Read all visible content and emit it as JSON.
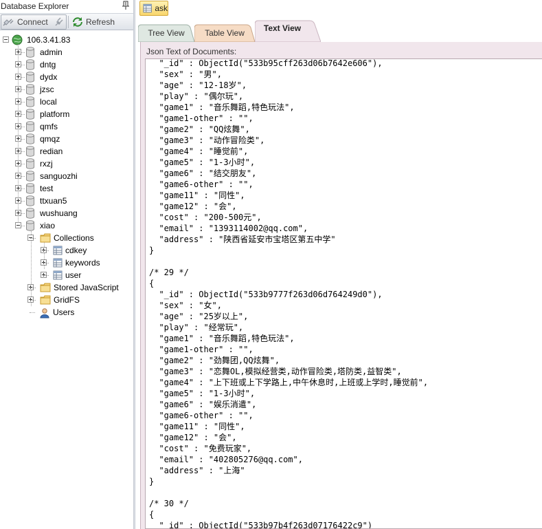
{
  "panel": {
    "title": "Database Explorer"
  },
  "toolbar": {
    "connect_label": "Connect",
    "refresh_label": "Refresh"
  },
  "tree": {
    "server": "106.3.41.83",
    "databases": [
      "admin",
      "dntg",
      "dydx",
      "jzsc",
      "local",
      "platform",
      "qmfs",
      "qmqz",
      "redian",
      "rxzj",
      "sanguozhi",
      "test",
      "ttxuan5",
      "wushuang",
      "xiao"
    ],
    "collections_label": "Collections",
    "collections": [
      "cdkey",
      "keywords",
      "user"
    ],
    "stored_js_label": "Stored JavaScript",
    "gridfs_label": "GridFS",
    "users_label": "Users"
  },
  "doc_tab": {
    "label": "ask"
  },
  "view_tabs": [
    "Tree View",
    "Table View",
    "Text View"
  ],
  "active_tab": "Text View",
  "json_caption": "Json Text of Documents:",
  "code_lines": [
    "  \"_id\" : ObjectId(\"533b95cff263d06b7642e606\"),",
    "  \"sex\" : \"男\",",
    "  \"age\" : \"12-18岁\",",
    "  \"play\" : \"偶尔玩\",",
    "  \"game1\" : \"音乐舞蹈,特色玩法\",",
    "  \"game1-other\" : \"\",",
    "  \"game2\" : \"QQ炫舞\",",
    "  \"game3\" : \"动作冒险类\",",
    "  \"game4\" : \"睡觉前\",",
    "  \"game5\" : \"1-3小时\",",
    "  \"game6\" : \"结交朋友\",",
    "  \"game6-other\" : \"\",",
    "  \"game11\" : \"同性\",",
    "  \"game12\" : \"会\",",
    "  \"cost\" : \"200-500元\",",
    "  \"email\" : \"1393114002@qq.com\",",
    "  \"address\" : \"陕西省延安市宝塔区第五中学\"",
    "}",
    "",
    "/* 29 */",
    "{",
    "  \"_id\" : ObjectId(\"533b9777f263d06d764249d0\"),",
    "  \"sex\" : \"女\",",
    "  \"age\" : \"25岁以上\",",
    "  \"play\" : \"经常玩\",",
    "  \"game1\" : \"音乐舞蹈,特色玩法\",",
    "  \"game1-other\" : \"\",",
    "  \"game2\" : \"劲舞团,QQ炫舞\",",
    "  \"game3\" : \"恋舞OL,模拟经营类,动作冒险类,塔防类,益智类\",",
    "  \"game4\" : \"上下班或上下学路上,中午休息时,上班或上学时,睡觉前\",",
    "  \"game5\" : \"1-3小时\",",
    "  \"game6\" : \"娱乐消遣\",",
    "  \"game6-other\" : \"\",",
    "  \"game11\" : \"同性\",",
    "  \"game12\" : \"会\",",
    "  \"cost\" : \"免费玩家\",",
    "  \"email\" : \"402805276@qq.com\",",
    "  \"address\" : \"上海\"",
    "}",
    "",
    "/* 30 */",
    "{",
    "  \"_id\" : ObjectId(\"533b97b4f263d07176422c9\")"
  ]
}
